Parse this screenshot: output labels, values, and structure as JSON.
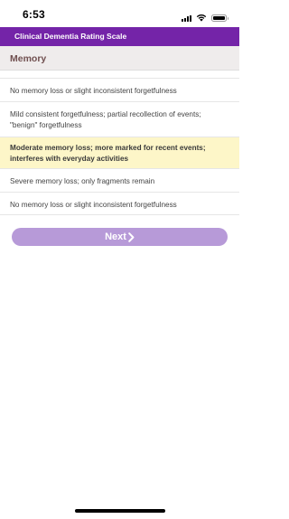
{
  "status_bar": {
    "time": "6:53",
    "icons": [
      "signal-icon",
      "wifi-icon",
      "battery-icon"
    ]
  },
  "header": {
    "title": "Clinical Dementia Rating Scale",
    "background": "#7424a8"
  },
  "section": {
    "title": "Memory"
  },
  "options": [
    {
      "label": "No memory loss or slight inconsistent forgetfulness",
      "selected": false
    },
    {
      "label": "Mild consistent forgetfulness; partial recollection of events; \"benign\" forgetfulness",
      "selected": false
    },
    {
      "label": "Moderate memory loss; more marked for recent events; interferes with everyday activities",
      "selected": true
    },
    {
      "label": "Severe memory loss; only fragments remain",
      "selected": false
    },
    {
      "label": "No memory loss or slight inconsistent forgetfulness",
      "selected": false
    }
  ],
  "next_button": {
    "label": "Next",
    "icon": "chevron-right-icon",
    "background": "#b79ad8"
  },
  "colors": {
    "accent": "#7424a8",
    "selected_background": "#fdf6c8",
    "section_text": "#704f4f"
  }
}
